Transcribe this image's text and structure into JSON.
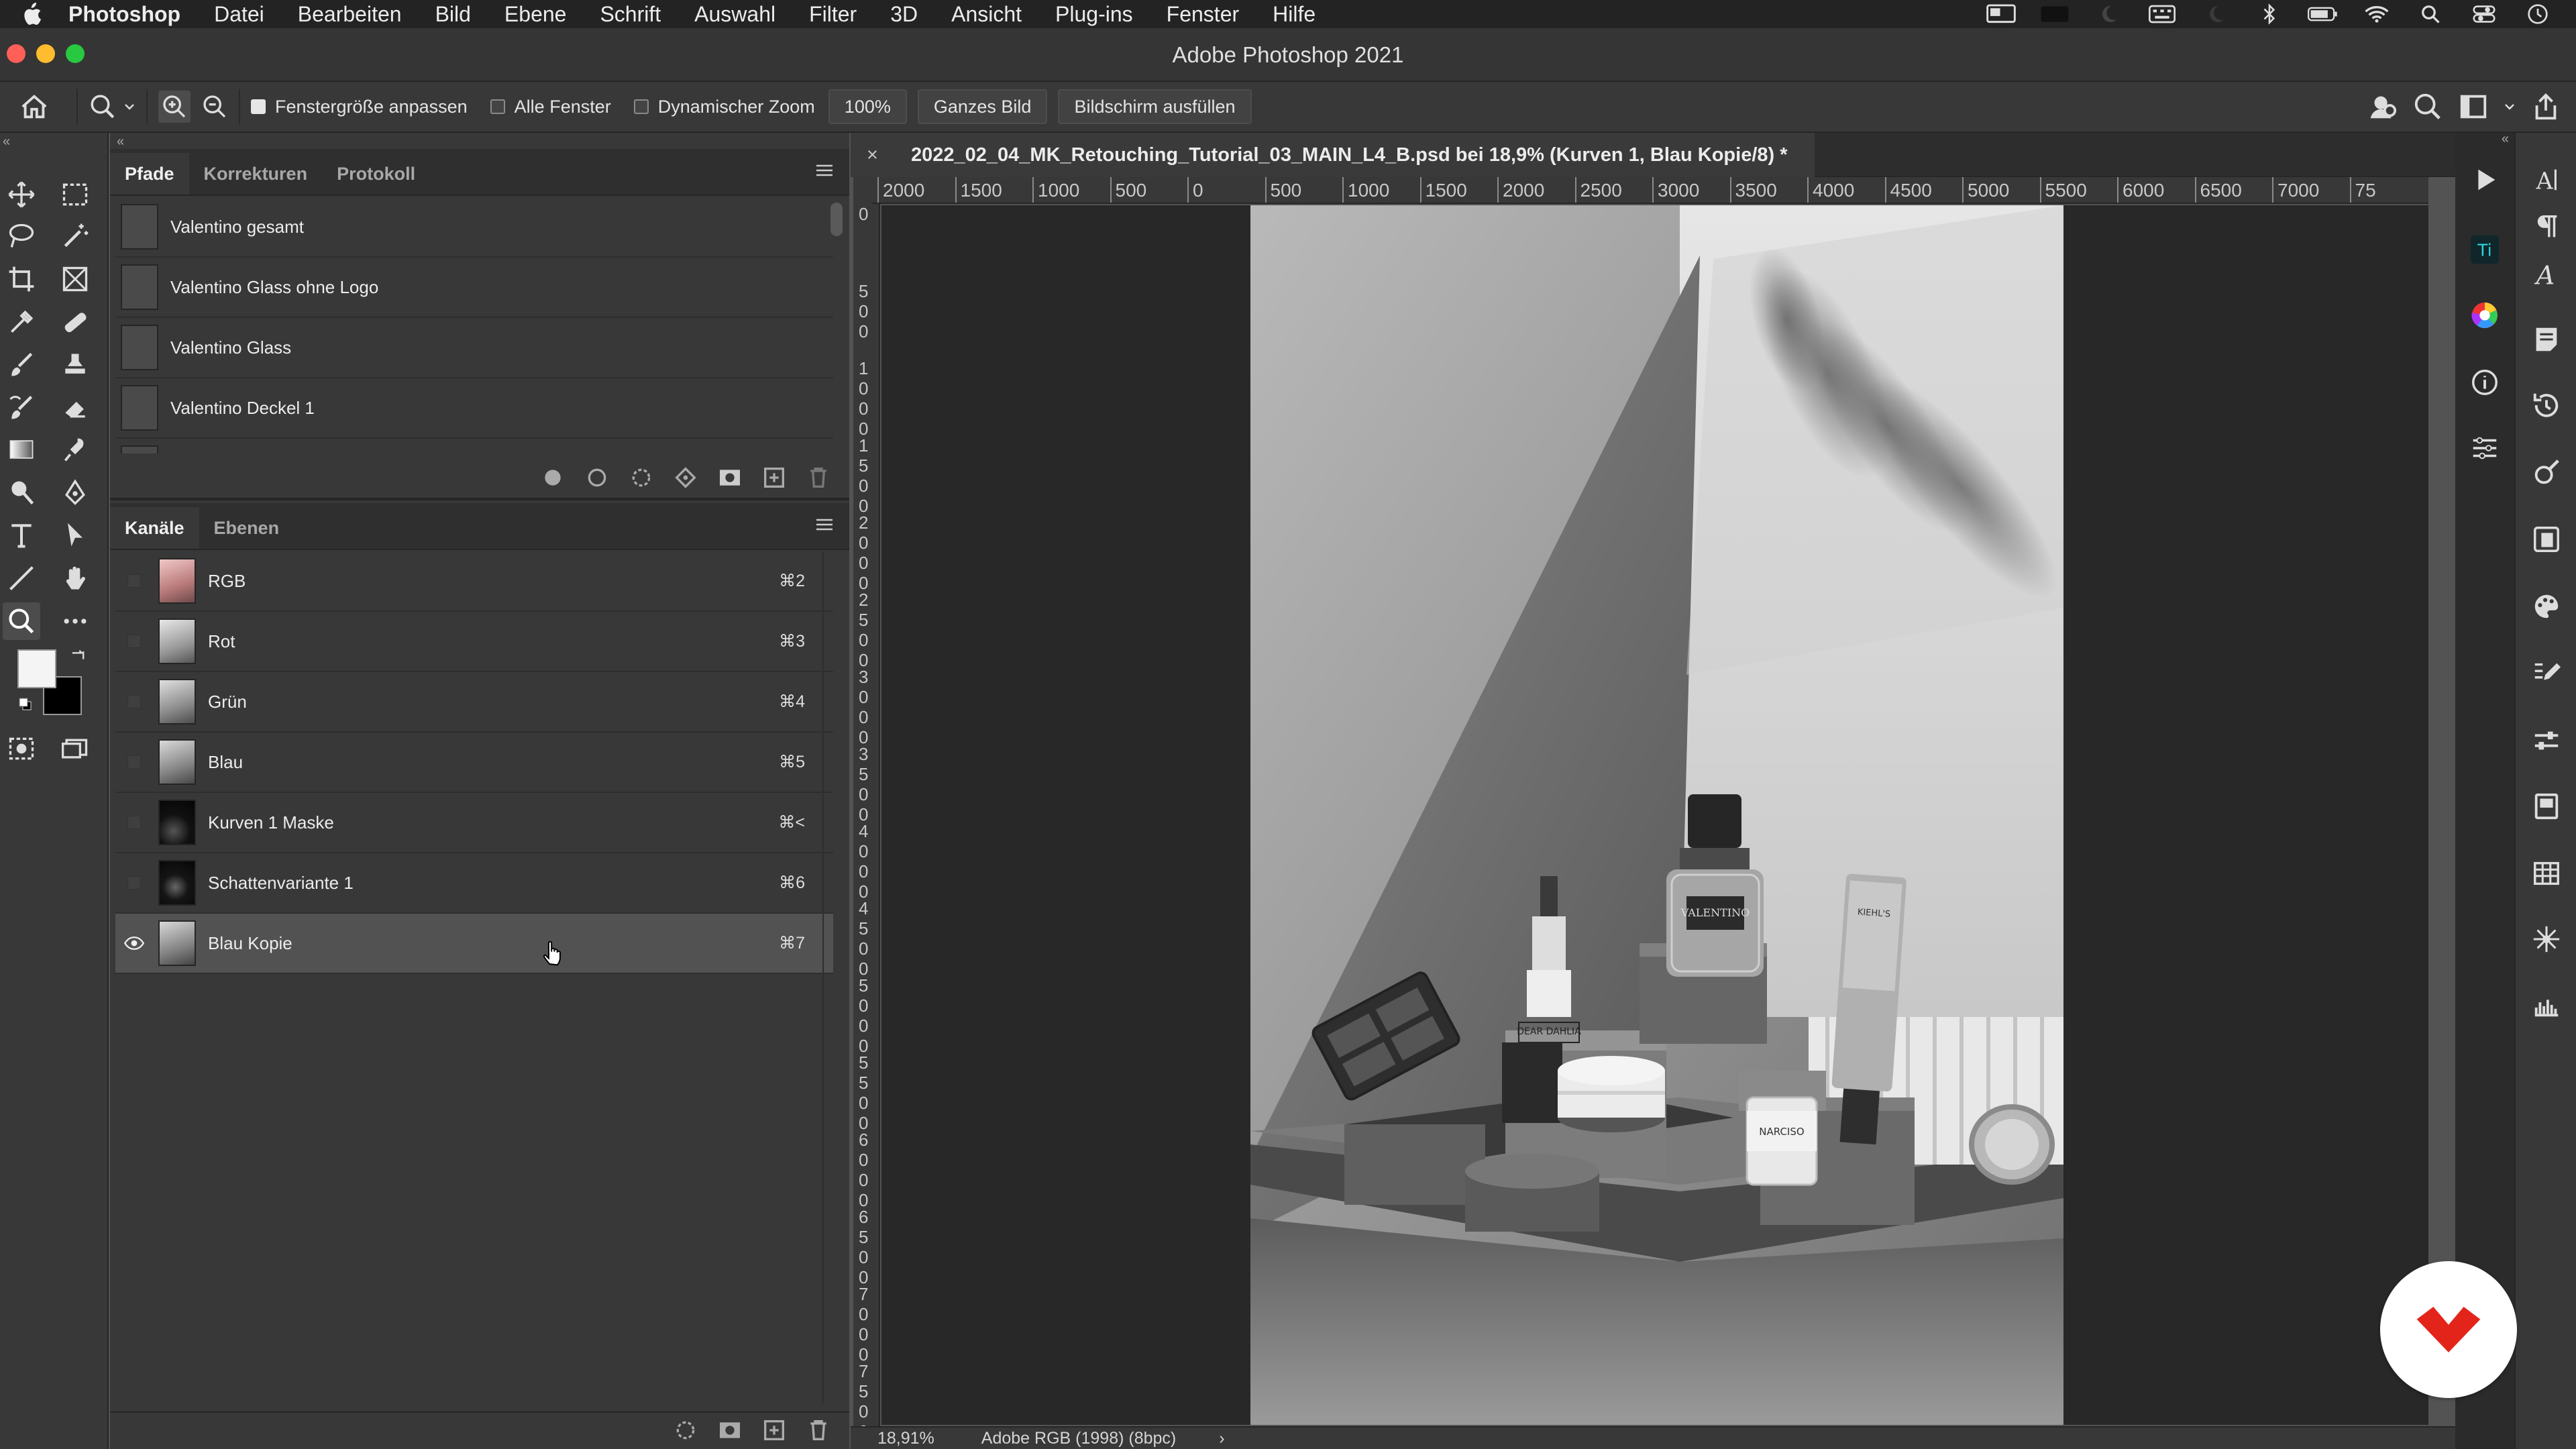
{
  "menubar": {
    "app_name": "Photoshop",
    "items": [
      "Datei",
      "Bearbeiten",
      "Bild",
      "Ebene",
      "Schrift",
      "Auswahl",
      "Filter",
      "3D",
      "Ansicht",
      "Plug-ins",
      "Fenster",
      "Hilfe"
    ]
  },
  "window": {
    "title": "Adobe Photoshop 2021"
  },
  "options": {
    "fit_window_label": "Fenstergröße anpassen",
    "fit_window_checked": true,
    "all_windows_label": "Alle Fenster",
    "all_windows_checked": false,
    "dynamic_zoom_label": "Dynamischer Zoom",
    "dynamic_zoom_checked": false,
    "zoom_value": "100%",
    "fit_screen_label": "Ganzes Bild",
    "fill_screen_label": "Bildschirm ausfüllen"
  },
  "paths_panel": {
    "tabs": [
      "Pfade",
      "Korrekturen",
      "Protokoll"
    ],
    "active_tab": "Pfade",
    "items": [
      "Valentino gesamt",
      "Valentino Glass ohne Logo",
      "Valentino Glass",
      "Valentino Deckel 1"
    ]
  },
  "channels_panel": {
    "tabs": [
      "Kanäle",
      "Ebenen"
    ],
    "active_tab": "Kanäle",
    "items": [
      {
        "name": "RGB",
        "shortcut": "⌘2"
      },
      {
        "name": "Rot",
        "shortcut": "⌘3"
      },
      {
        "name": "Grün",
        "shortcut": "⌘4"
      },
      {
        "name": "Blau",
        "shortcut": "⌘5"
      },
      {
        "name": "Kurven 1 Maske",
        "shortcut": "⌘<"
      },
      {
        "name": "Schattenvariante 1",
        "shortcut": "⌘6"
      },
      {
        "name": "Blau Kopie",
        "shortcut": "⌘7"
      }
    ],
    "selected": "Blau Kopie"
  },
  "document": {
    "tab_title": "2022_02_04_MK_Retouching_Tutorial_03_MAIN_L4_B.psd bei 18,9% (Kurven 1, Blau Kopie/8) *",
    "close_glyph": "×",
    "zoom": "18,91%",
    "color_profile": "Adobe RGB (1998) (8bpc)",
    "status_arrow": "›"
  },
  "ruler_top": [
    "2000",
    "1500",
    "1000",
    "500",
    "0",
    "500",
    "1000",
    "1500",
    "2000",
    "2500",
    "3000",
    "3500",
    "4000",
    "4500",
    "5000",
    "5500",
    "6000",
    "6500",
    "7000",
    "75"
  ],
  "ruler_left": [
    "0",
    "5 0 0",
    "1 0 0 0",
    "1 5 0 0",
    "2 0 0 0",
    "2 5 0 0",
    "3 0 0 0",
    "3 5 0 0",
    "4 0 0 0",
    "4 5 0 0",
    "5 0 0 0",
    "5 5 0 0",
    "6 0 0 0",
    "6 5 0 0",
    "7 0 0 0",
    "7 5 0 0"
  ],
  "photo_labels": {
    "perfume_brand": "VALENTINO",
    "lipstick_label": "DEAR DAHLIA",
    "bottle_label": "NARCISO",
    "tube_label": "KIEHL'S"
  },
  "colors": {
    "accent": "#e3241b",
    "panel": "#383838",
    "canvas": "#282828"
  }
}
